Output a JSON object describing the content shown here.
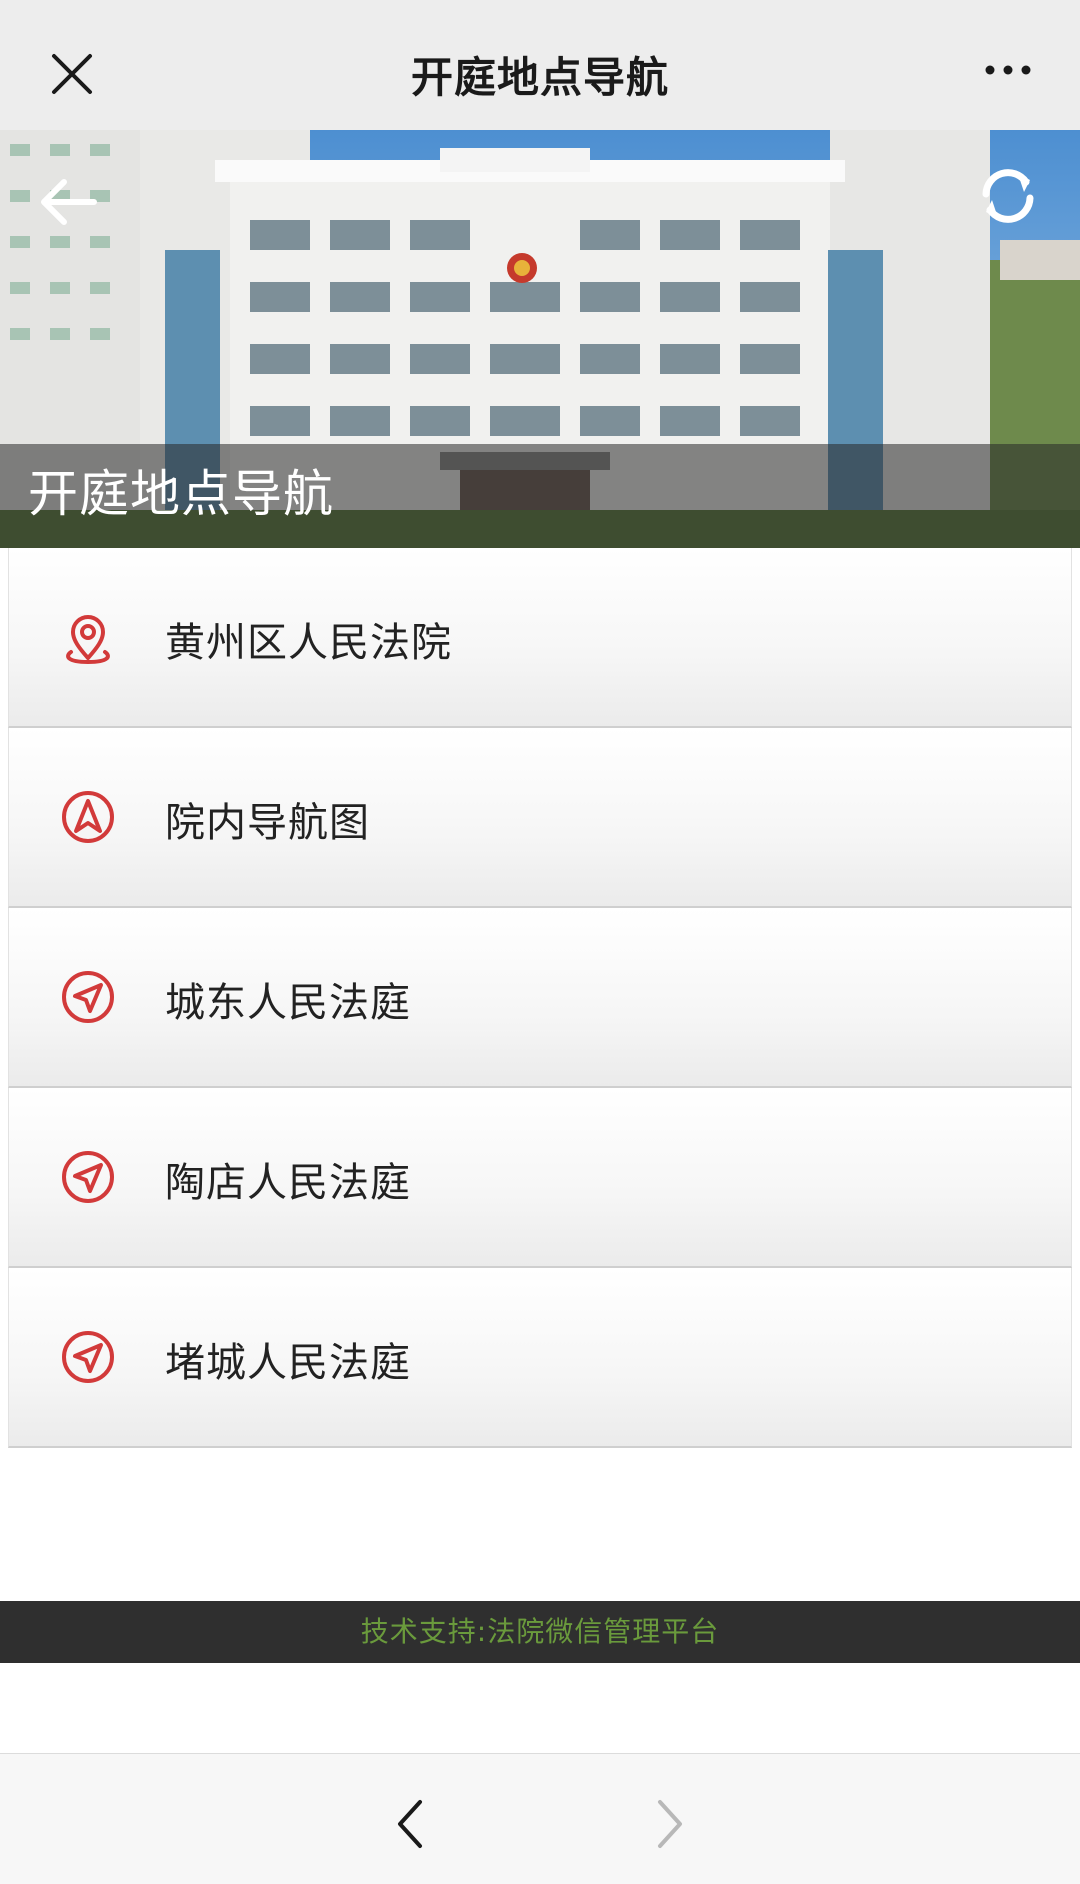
{
  "header": {
    "title": "开庭地点导航",
    "close_icon": "close-icon",
    "more_icon": "more-icon"
  },
  "hero": {
    "caption": "开庭地点导航",
    "back_icon": "back-arrow-icon",
    "refresh_icon": "refresh-icon"
  },
  "nav_items": [
    {
      "label": "黄州区人民法院",
      "icon": "location-pin-icon"
    },
    {
      "label": "院内导航图",
      "icon": "navigation-compass-icon"
    },
    {
      "label": "城东人民法庭",
      "icon": "send-arrow-icon"
    },
    {
      "label": "陶店人民法庭",
      "icon": "send-arrow-icon"
    },
    {
      "label": "堵城人民法庭",
      "icon": "send-arrow-icon"
    }
  ],
  "footer": {
    "text": "技术支持:法院微信管理平台"
  },
  "colors": {
    "accent_red": "#d23a3a",
    "footer_bg": "#2f2f2f",
    "footer_text": "#6a9a3c"
  }
}
